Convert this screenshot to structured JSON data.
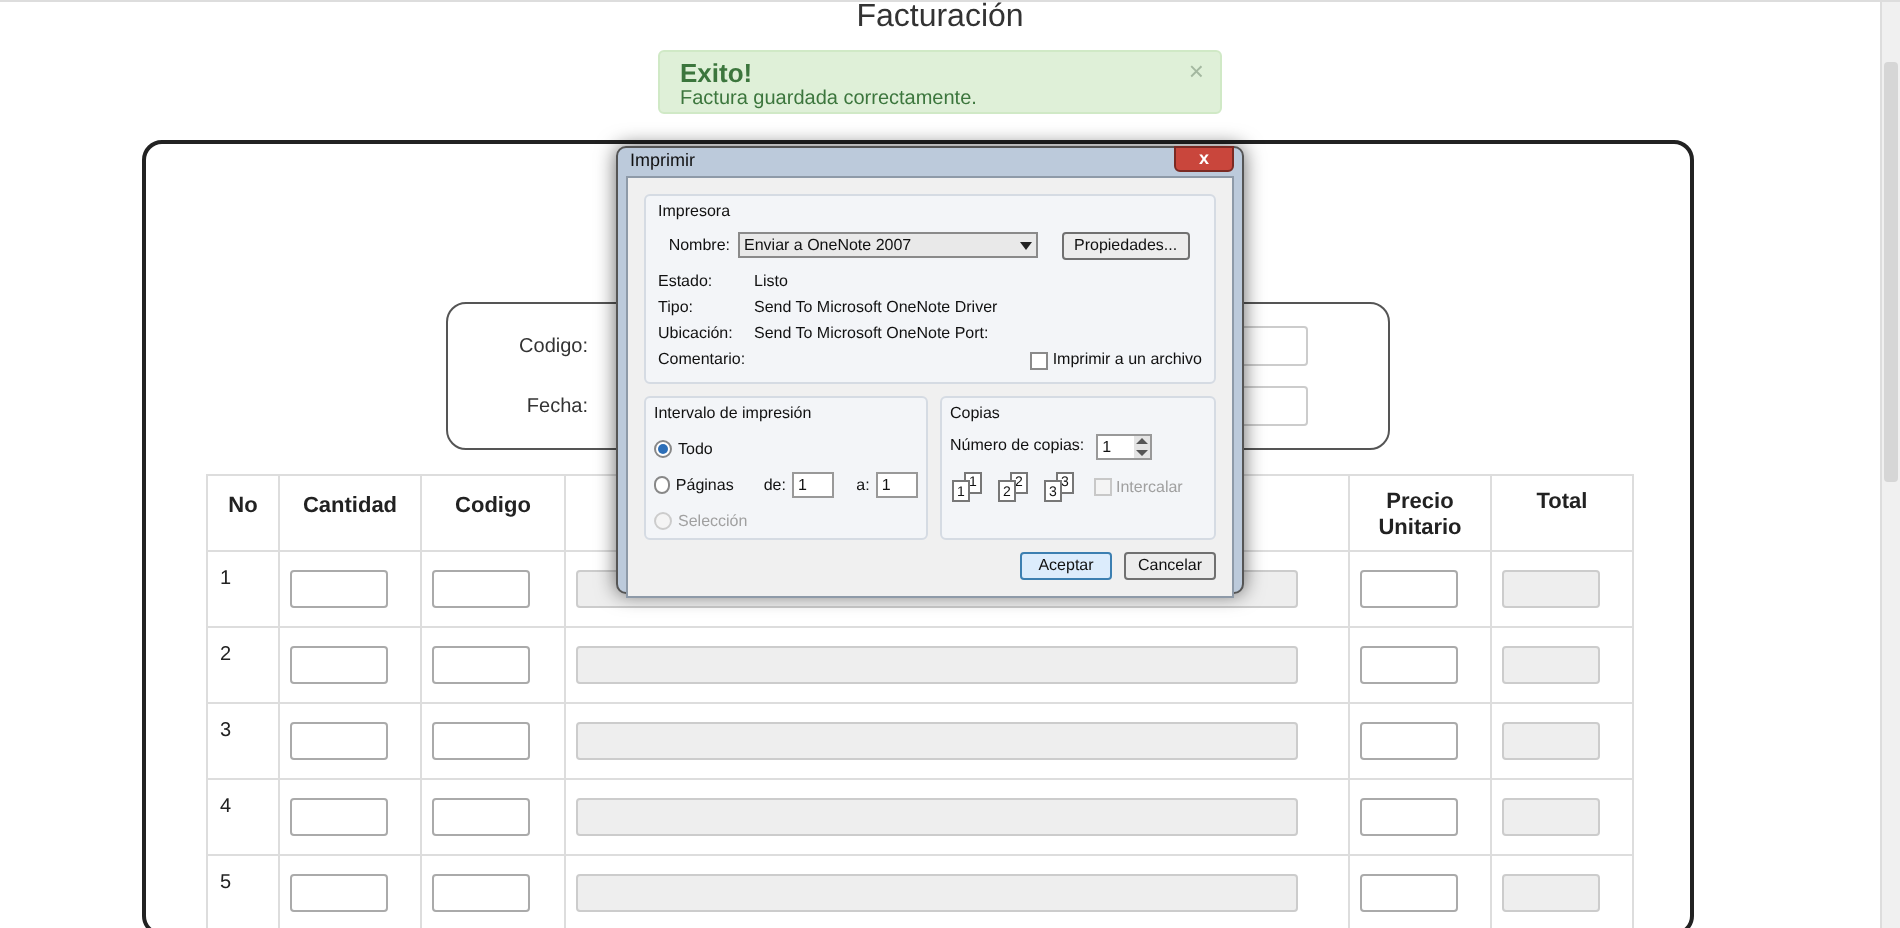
{
  "page_title": "Facturación",
  "alert": {
    "title": "Exito!",
    "message": "Factura guardada correctamente.",
    "close": "×"
  },
  "invoice_header": {
    "fields": [
      {
        "label": "Codigo:"
      },
      {
        "label": "Fecha:"
      }
    ]
  },
  "table": {
    "columns": [
      "No",
      "Cantidad",
      "Codigo",
      "Precio Unitario",
      "Total"
    ],
    "rows": [
      {
        "no": "1"
      },
      {
        "no": "2"
      },
      {
        "no": "3"
      },
      {
        "no": "4"
      },
      {
        "no": "5"
      }
    ]
  },
  "print_dialog": {
    "title": "Imprimir",
    "close": "x",
    "printer": {
      "legend": "Impresora",
      "name_label": "Nombre:",
      "name_value": "Enviar a OneNote 2007",
      "properties_button": "Propiedades...",
      "info": [
        {
          "label": "Estado:",
          "value": "Listo"
        },
        {
          "label": "Tipo:",
          "value": "Send To Microsoft OneNote Driver"
        },
        {
          "label": "Ubicación:",
          "value": "Send To Microsoft OneNote Port:"
        },
        {
          "label": "Comentario:"
        }
      ],
      "print_to_file": {
        "label": "Imprimir a un archivo",
        "checked": false
      }
    },
    "range": {
      "legend": "Intervalo de impresión",
      "options": [
        {
          "label": "Todo",
          "selected": true,
          "disabled": false
        },
        {
          "label": "Páginas",
          "selected": false,
          "disabled": false,
          "from_label": "de:",
          "from": "1",
          "to_label": "a:",
          "to": "1"
        },
        {
          "label": "Selección",
          "selected": false,
          "disabled": true
        }
      ]
    },
    "copies": {
      "legend": "Copias",
      "count_label": "Número de copias:",
      "count": "1",
      "pages": [
        [
          "1",
          "1"
        ],
        [
          "2",
          "2"
        ],
        [
          "3",
          "3"
        ]
      ],
      "collate": {
        "label": "Intercalar",
        "checked": false,
        "disabled": true
      }
    },
    "buttons": [
      {
        "label": "Aceptar",
        "selected": true
      },
      {
        "label": "Cancelar",
        "selected": false
      }
    ]
  }
}
